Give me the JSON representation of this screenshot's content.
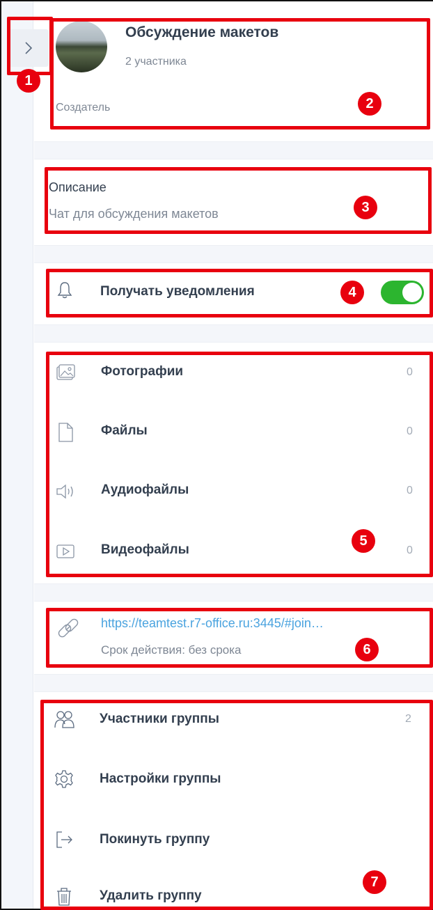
{
  "group": {
    "title": "Обсуждение макетов",
    "members_count_label": "2 участника",
    "role_label": "Создатель"
  },
  "description": {
    "label": "Описание",
    "text": "Чат для обсуждения макетов"
  },
  "notifications": {
    "label": "Получать уведомления",
    "enabled": true,
    "toggle_color": "#2cb52f"
  },
  "media": [
    {
      "label": "Фотографии",
      "count": "0",
      "icon": "photo-icon"
    },
    {
      "label": "Файлы",
      "count": "0",
      "icon": "file-icon"
    },
    {
      "label": "Аудиофайлы",
      "count": "0",
      "icon": "audio-icon"
    },
    {
      "label": "Видеофайлы",
      "count": "0",
      "icon": "video-icon"
    }
  ],
  "invite_link": {
    "url": "https://teamtest.r7-office.ru:3445/#join…",
    "expiry": "Срок действия: без срока"
  },
  "group_actions": [
    {
      "label": "Участники группы",
      "count": "2",
      "icon": "members-icon"
    },
    {
      "label": "Настройки группы",
      "count": "",
      "icon": "gear-icon"
    },
    {
      "label": "Покинуть группу",
      "count": "",
      "icon": "leave-icon"
    },
    {
      "label": "Удалить группу",
      "count": "",
      "icon": "trash-icon"
    }
  ],
  "annotations": {
    "color": "#e8000e",
    "badges": [
      "1",
      "2",
      "3",
      "4",
      "5",
      "6",
      "7"
    ]
  }
}
